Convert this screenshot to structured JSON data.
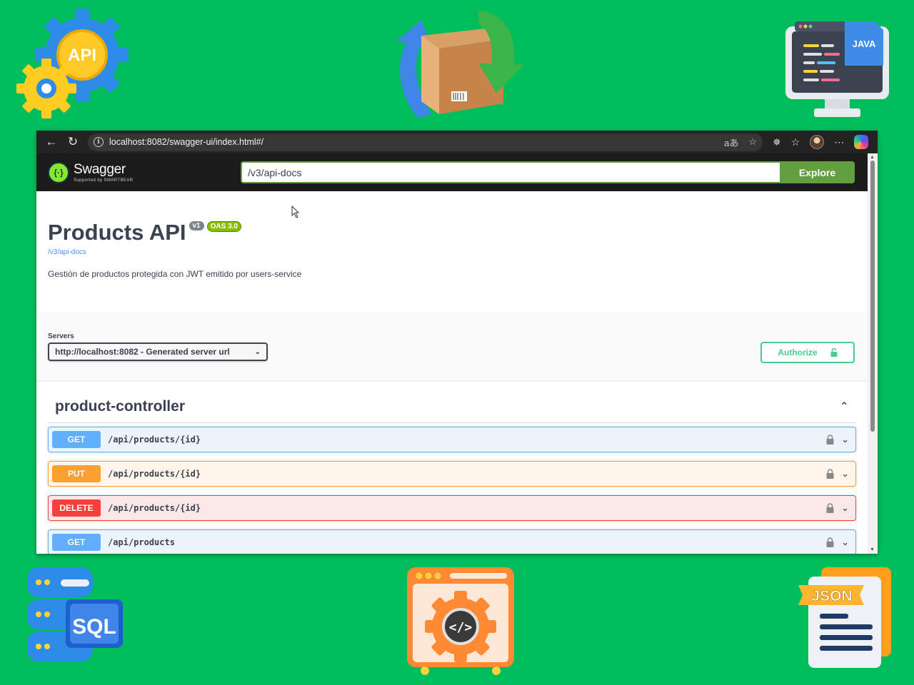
{
  "browser": {
    "url": "localhost:8082/swagger-ui/index.html#/",
    "reader_icon": "aあ"
  },
  "swagger": {
    "logo_name": "Swagger",
    "logo_sub": "Supported by SMARTBEAR",
    "spec_url": "/v3/api-docs",
    "explore_label": "Explore"
  },
  "info": {
    "title": "Products API",
    "version_badge": "v1",
    "oas_badge": "OAS 3.0",
    "spec_link": "/v3/api-docs",
    "description": "Gestión de productos protegida con JWT emitido por users-service"
  },
  "servers": {
    "label": "Servers",
    "selected": "http://localhost:8082 - Generated server url",
    "authorize_label": "Authorize"
  },
  "tag": {
    "name": "product-controller"
  },
  "operations": [
    {
      "method": "GET",
      "path": "/api/products/{id}"
    },
    {
      "method": "PUT",
      "path": "/api/products/{id}"
    },
    {
      "method": "DELETE",
      "path": "/api/products/{id}"
    },
    {
      "method": "GET",
      "path": "/api/products"
    }
  ],
  "decorations": {
    "gear_label": "API",
    "java_label": "JAVA",
    "sql_label": "SQL",
    "json_label": "JSON"
  },
  "colors": {
    "background": "#00bd5c",
    "get": "#61affe",
    "put": "#fca130",
    "delete": "#f93e3e",
    "authorize": "#49cc90",
    "explore": "#62a03f"
  }
}
